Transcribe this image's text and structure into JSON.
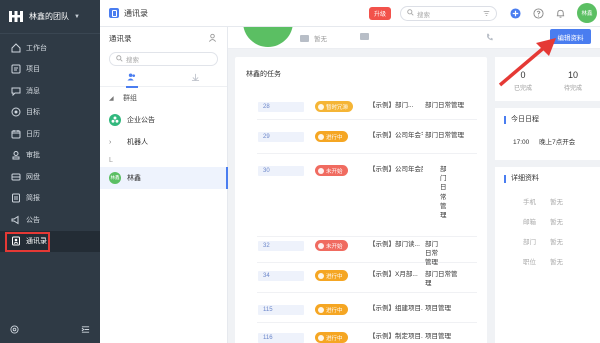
{
  "sidebar": {
    "team_name": "林鑫的团队",
    "items": [
      {
        "label": "工作台",
        "icon": "home-icon"
      },
      {
        "label": "项目",
        "icon": "project-icon"
      },
      {
        "label": "消息",
        "icon": "message-icon"
      },
      {
        "label": "目标",
        "icon": "target-icon"
      },
      {
        "label": "日历",
        "icon": "calendar-icon"
      },
      {
        "label": "审批",
        "icon": "approval-icon"
      },
      {
        "label": "网盘",
        "icon": "cloud-disk-icon"
      },
      {
        "label": "简报",
        "icon": "report-icon"
      },
      {
        "label": "公告",
        "icon": "announcement-icon"
      },
      {
        "label": "通讯录",
        "icon": "contacts-icon",
        "active": true
      }
    ],
    "highlight_color": "#e53935"
  },
  "topbar": {
    "title": "通讯录",
    "upgrade_label": "升级",
    "search_placeholder": "搜索",
    "avatar_text": "林鑫"
  },
  "contacts": {
    "title": "通讯录",
    "search_placeholder": "搜索",
    "group_label": "群组",
    "items": [
      {
        "label": "企业公告"
      },
      {
        "label": "机器人"
      }
    ],
    "letter": "L",
    "selected": {
      "label": "林鑫",
      "avatar_text": "林鑫"
    }
  },
  "profile": {
    "field1": "暂无",
    "edit_label": "编辑资料"
  },
  "tasks": {
    "title": "林鑫的任务",
    "rows": [
      {
        "num": "28",
        "status": "暂时冗滞",
        "color": "yellow",
        "name": "【示例】部门...",
        "project": "部门日常管理"
      },
      {
        "num": "29",
        "status": "进行中",
        "color": "orange",
        "name": "【示例】公司年会节...",
        "project": "部门日常管理"
      },
      {
        "num": "30",
        "status": "未开始",
        "color": "red",
        "name": "【示例】公司年会服装借...",
        "project": "部门日常管理"
      },
      {
        "num": "32",
        "status": "未开始",
        "color": "red",
        "name": "【示例】部门读...",
        "project": "部门日常管理"
      },
      {
        "num": "34",
        "status": "进行中",
        "color": "orange",
        "name": "【示例】X月部...",
        "project": "部门日常管理"
      },
      {
        "num": "115",
        "status": "进行中",
        "color": "orange",
        "name": "【示例】组建项目...",
        "project": "项目管理"
      },
      {
        "num": "116",
        "status": "进行中",
        "color": "orange",
        "name": "【示例】制定项目...",
        "project": "项目管理"
      }
    ]
  },
  "stats": {
    "done_value": "0",
    "done_label": "已完成",
    "todo_value": "10",
    "todo_label": "待完成"
  },
  "schedule": {
    "title": "今日日程",
    "time": "17:00",
    "event": "晚上7点开会"
  },
  "details": {
    "title": "详细资料",
    "rows": [
      {
        "key": "手机",
        "value": "暂无"
      },
      {
        "key": "邮箱",
        "value": "暂无"
      },
      {
        "key": "部门",
        "value": "暂无"
      },
      {
        "key": "职位",
        "value": "暂无"
      }
    ]
  },
  "accent_color": "#4a7df0"
}
